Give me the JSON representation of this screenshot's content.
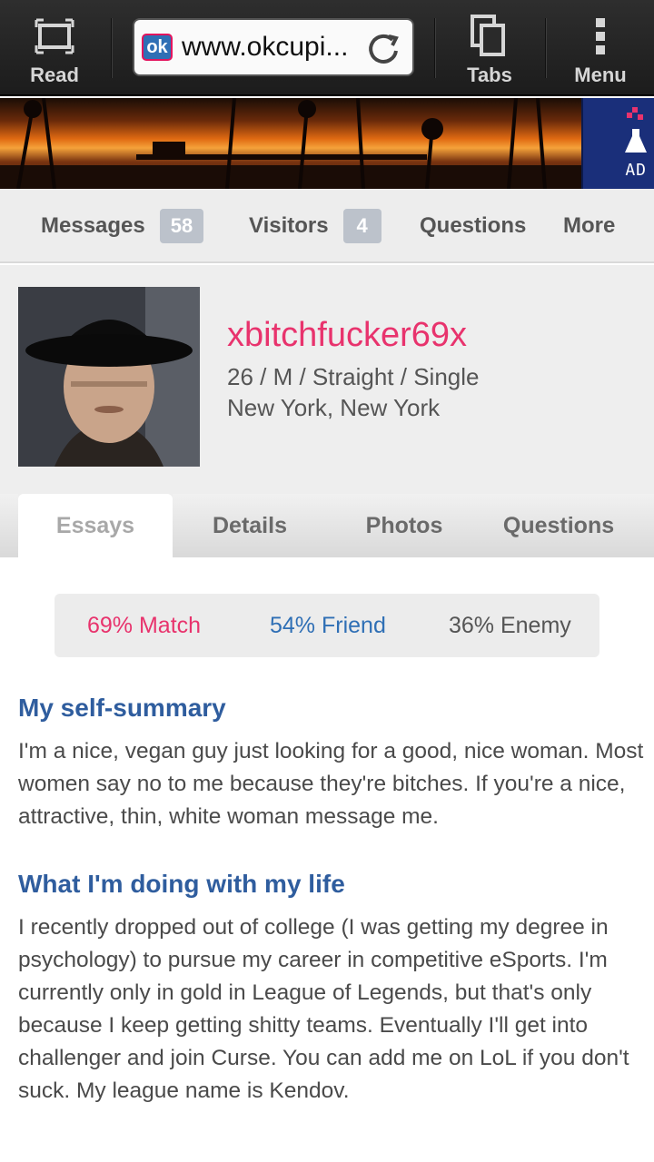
{
  "browser": {
    "read_label": "Read",
    "url_text": "www.okcupi...",
    "site_logo_text": "ok",
    "tabs_label": "Tabs",
    "menu_label": "Menu"
  },
  "ad": {
    "label": "AD"
  },
  "nav": {
    "messages_label": "Messages",
    "messages_count": "58",
    "visitors_label": "Visitors",
    "visitors_count": "4",
    "questions_label": "Questions",
    "more_label": "More"
  },
  "profile": {
    "username": "xbitchfucker69x",
    "details": "26 / M / Straight / Single",
    "location": "New York, New York"
  },
  "tabs": [
    {
      "label": "Essays",
      "active": true
    },
    {
      "label": "Details",
      "active": false
    },
    {
      "label": "Photos",
      "active": false
    },
    {
      "label": "Questions",
      "active": false
    }
  ],
  "match": {
    "match_label": "69% Match",
    "friend_label": "54% Friend",
    "enemy_label": "36% Enemy"
  },
  "essays": [
    {
      "heading": "My self-summary",
      "body": "I'm a nice, vegan guy just looking for a good, nice woman. Most women say no to me because they're bitches. If you're a nice, attractive, thin, white woman message me."
    },
    {
      "heading": "What I'm doing with my life",
      "body": "I recently dropped out of college (I was getting my degree in psychology) to pursue my career in competitive eSports. I'm currently only in gold in League of Legends, but that's only because I keep getting shitty teams. Eventually I'll get into challenger and join Curse. You can add me on LoL if you don't suck. My league name is Kendov."
    }
  ],
  "colors": {
    "username": "#e8336d",
    "match": "#e8336d",
    "friend": "#2f6fb5",
    "enemy": "#555555",
    "heading": "#2f5d9e"
  }
}
